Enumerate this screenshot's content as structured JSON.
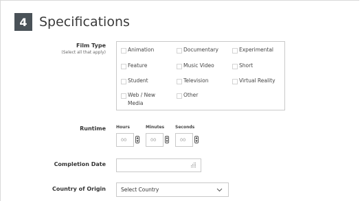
{
  "section": {
    "number": "4",
    "title": "Specifications"
  },
  "film_type": {
    "label": "Film Type",
    "sublabel": "(Select all that apply)",
    "options": [
      "Animation",
      "Documentary",
      "Experimental",
      "Feature",
      "Music Video",
      "Short",
      "Student",
      "Television",
      "Virtual Reality",
      "Web / New Media",
      "Other"
    ]
  },
  "runtime": {
    "label": "Runtime",
    "hours": {
      "label": "Hours",
      "placeholder": "00"
    },
    "minutes": {
      "label": "Minutes",
      "placeholder": "00"
    },
    "seconds": {
      "label": "Seconds",
      "placeholder": "00"
    }
  },
  "completion_date": {
    "label": "Completion Date",
    "value": ""
  },
  "country": {
    "label": "Country of Origin",
    "selected": "Select Country"
  },
  "icons": {
    "calendar": "calendar-icon",
    "dropdown": "chevron-down-icon",
    "spinner": "spinner-icon"
  }
}
